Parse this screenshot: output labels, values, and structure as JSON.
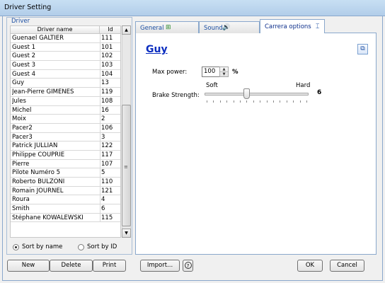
{
  "window": {
    "title": "Driver Setting"
  },
  "driver_group": {
    "legend": "Driver"
  },
  "list": {
    "headers": {
      "name": "Driver name",
      "id": "Id"
    },
    "rows": [
      {
        "name": "Guenael GALTIER",
        "id": "111"
      },
      {
        "name": "Guest 1",
        "id": "101"
      },
      {
        "name": "Guest 2",
        "id": "102"
      },
      {
        "name": "Guest 3",
        "id": "103"
      },
      {
        "name": "Guest 4",
        "id": "104"
      },
      {
        "name": "Guy",
        "id": "13"
      },
      {
        "name": "Jean-Pierre GIMENES",
        "id": "119"
      },
      {
        "name": "Jules",
        "id": "108"
      },
      {
        "name": "Michel",
        "id": "16"
      },
      {
        "name": "Moix",
        "id": "2"
      },
      {
        "name": "Pacer2",
        "id": "106"
      },
      {
        "name": "Pacer3",
        "id": "3"
      },
      {
        "name": "Patrick JULLIAN",
        "id": "122"
      },
      {
        "name": "Philippe COUPRIE",
        "id": "117"
      },
      {
        "name": "Pierre",
        "id": "107"
      },
      {
        "name": "Pilote Numéro 5",
        "id": "5"
      },
      {
        "name": "Roberto BULZONI",
        "id": "110"
      },
      {
        "name": "Romain JOURNEL",
        "id": "121"
      },
      {
        "name": "Roura",
        "id": "4"
      },
      {
        "name": "Smith",
        "id": "6"
      },
      {
        "name": "Stéphane KOWALEWSKI",
        "id": "115"
      }
    ]
  },
  "sort": {
    "by_name": "Sort by name",
    "by_id": "Sort by ID",
    "selected": "by_name"
  },
  "tabs": {
    "general": "General",
    "sound": "Sound",
    "carrera": "Carrera options",
    "active": "carrera"
  },
  "carrera": {
    "driver_name": "Guy",
    "max_power_label": "Max power:",
    "max_power_value": "100",
    "percent_symbol": "%",
    "brake_label": "Brake Strength:",
    "soft_label": "Soft",
    "hard_label": "Hard",
    "brake_value": "6",
    "brake_min": 0,
    "brake_max": 15
  },
  "buttons": {
    "new": "New",
    "delete": "Delete",
    "print": "Print",
    "import": "Import...",
    "help": "?",
    "ok": "OK",
    "cancel": "Cancel"
  }
}
